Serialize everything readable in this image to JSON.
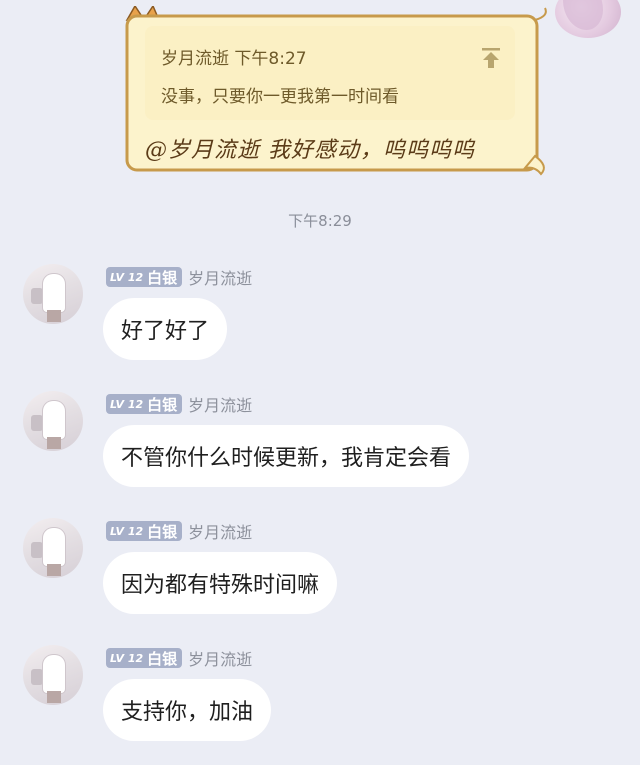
{
  "quoted_card": {
    "meta": "岁月流逝 下午8:27",
    "text": "没事，只要你一更我第一时间看",
    "caption": "@岁月流逝 我好感动，呜呜呜呜",
    "icons": [
      "pin-to-top-icon"
    ],
    "colors": {
      "card_bg": "#fbf0c4",
      "border": "#c79a4b"
    }
  },
  "timestamp": "下午8:29",
  "messages": [
    {
      "level": "LV 12",
      "title": "白银",
      "sender": "岁月流逝",
      "text": "好了好了"
    },
    {
      "level": "LV 12",
      "title": "白银",
      "sender": "岁月流逝",
      "text": "不管你什么时候更新，我肯定会看"
    },
    {
      "level": "LV 12",
      "title": "白银",
      "sender": "岁月流逝",
      "text": "因为都有特殊时间嘛"
    },
    {
      "level": "LV 12",
      "title": "白银",
      "sender": "岁月流逝",
      "text": "支持你，加油"
    }
  ],
  "colors": {
    "background": "#ebedf5",
    "bubble": "#ffffff",
    "badge": "#a7b0c9"
  }
}
